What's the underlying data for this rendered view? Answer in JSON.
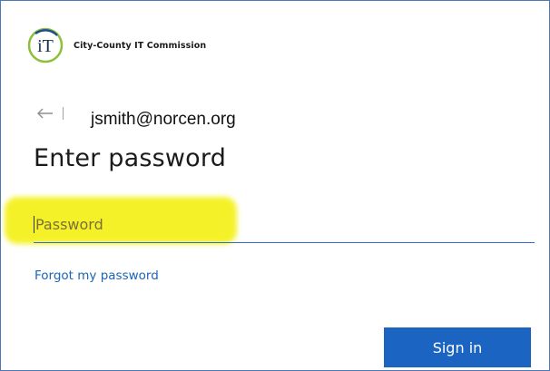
{
  "brand": {
    "logo_text": "iT",
    "org_name": "City-County IT Commission",
    "colors": {
      "ring": "#8dbf3b",
      "ink": "#1b4d8f"
    }
  },
  "identity": {
    "back_icon": "left-arrow-icon",
    "email": "jsmith@norcen.org"
  },
  "form": {
    "title": "Enter password",
    "password_placeholder": "Password",
    "forgot_link": "Forgot my password",
    "sign_in_label": "Sign in"
  },
  "colors": {
    "accent": "#1b64c2",
    "link": "#1c64b7",
    "highlight": "#f4f016"
  }
}
